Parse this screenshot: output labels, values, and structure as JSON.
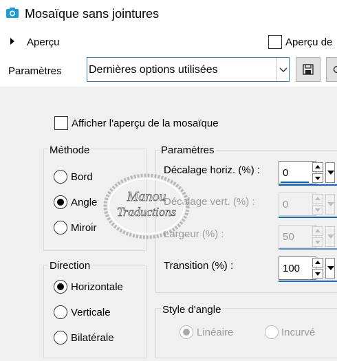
{
  "window": {
    "title": "Mosaïque sans jointures"
  },
  "preview": {
    "section_label": "Aperçu",
    "checkbox_label": "Aperçu de",
    "checkbox_checked": false
  },
  "presets": {
    "label": "Paramètres",
    "selected": "Dernières options utilisées"
  },
  "panel": {
    "show_tile_label": "Afficher l'aperçu de la mosaïque",
    "show_tile_checked": false,
    "method": {
      "title": "Méthode",
      "options": [
        "Bord",
        "Angle",
        "Miroir"
      ],
      "selected": "Angle"
    },
    "direction": {
      "title": "Direction",
      "options": [
        "Horizontale",
        "Verticale",
        "Bilatérale"
      ],
      "selected": "Horizontale"
    },
    "parameters": {
      "title": "Paramètres",
      "fields": [
        {
          "label": "Décalage horiz. (%) :",
          "value": "0",
          "enabled": true
        },
        {
          "label": "Décalage vert. (%) :",
          "value": "0",
          "enabled": false
        },
        {
          "label": "Largeur (%) :",
          "value": "50",
          "enabled": false
        },
        {
          "label": "Transition (%) :",
          "value": "100",
          "enabled": true
        }
      ]
    },
    "corner_style": {
      "title": "Style d'angle",
      "options": [
        "Linéaire",
        "Incurvé"
      ],
      "selected": "Linéaire",
      "enabled": false
    }
  },
  "watermark": {
    "line1": "Manou",
    "line2": "Traductions"
  },
  "colors": {
    "accent": "#0a64c8",
    "panel_bg": "#f0f0f0",
    "select_border": "#2a7bd1",
    "icon_cyan": "#1b9bd7"
  },
  "icons": [
    "app-camera-icon",
    "expand-arrow-icon",
    "floppy-save-icon",
    "spin-up-icon",
    "spin-down-icon",
    "dropdown-arrow-icon"
  ]
}
